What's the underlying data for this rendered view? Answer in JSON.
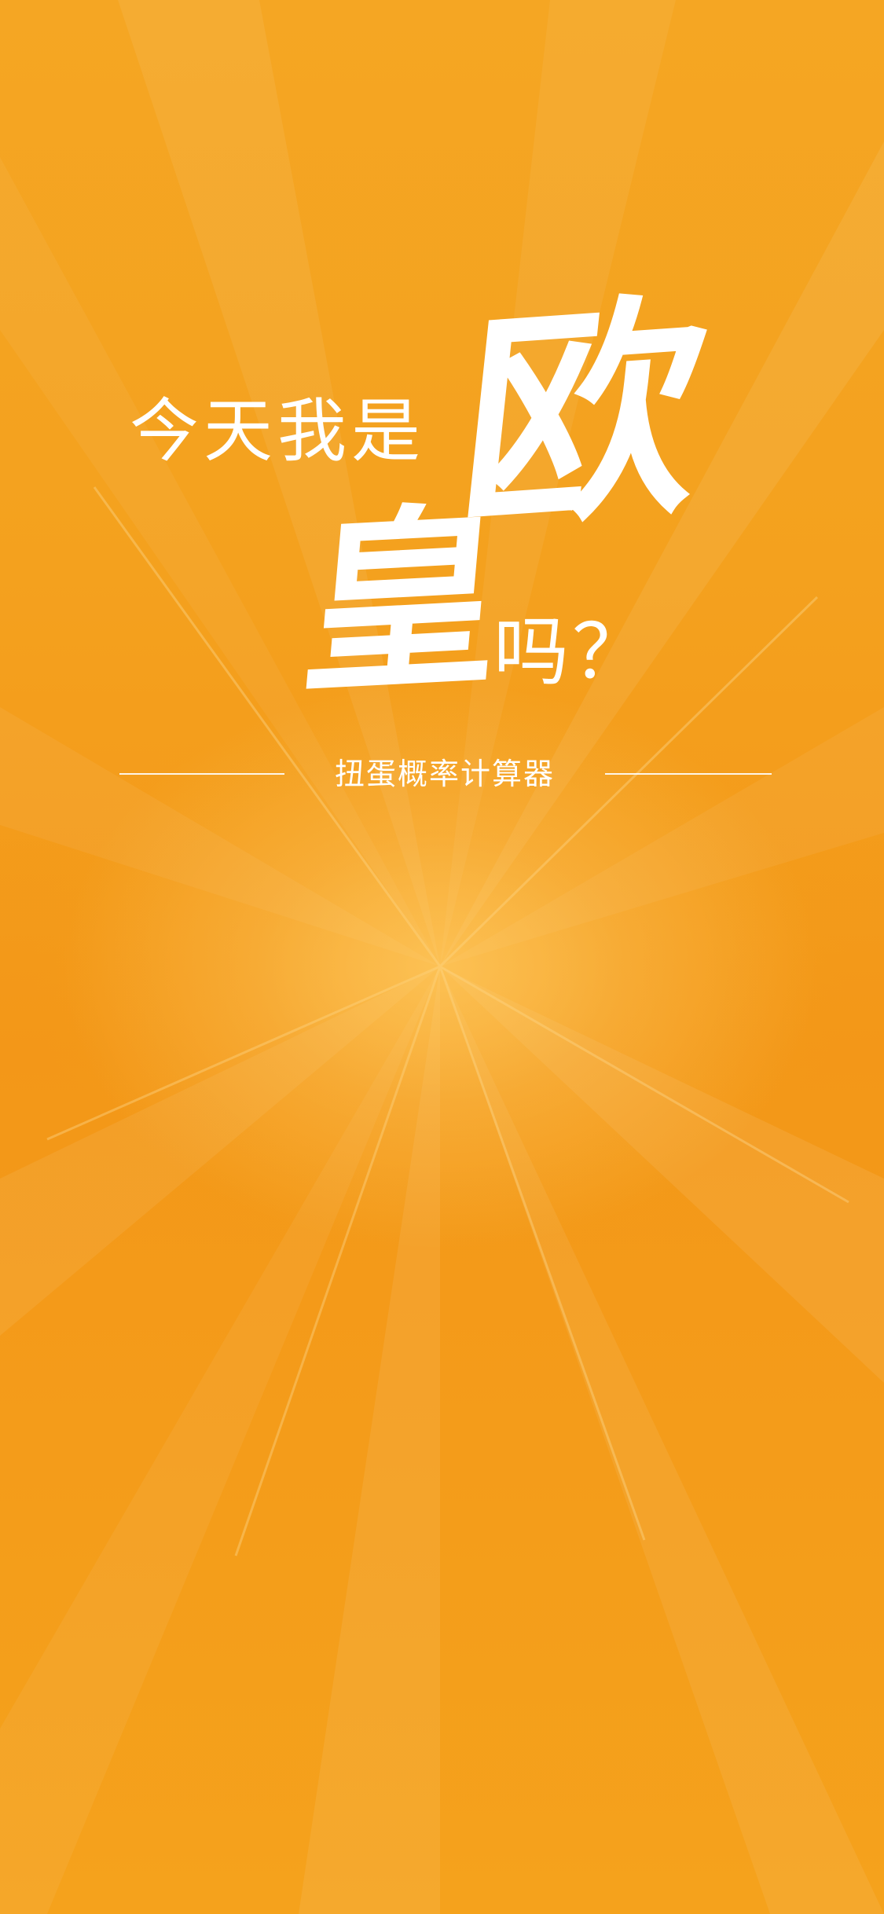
{
  "headline": {
    "line1": "今天我是",
    "big_char_1": "欧",
    "big_char_2": "皇",
    "line2": "吗？"
  },
  "subtitle": "扭蛋概率计算器",
  "colors": {
    "background": "#f39a13",
    "text": "#ffffff"
  }
}
